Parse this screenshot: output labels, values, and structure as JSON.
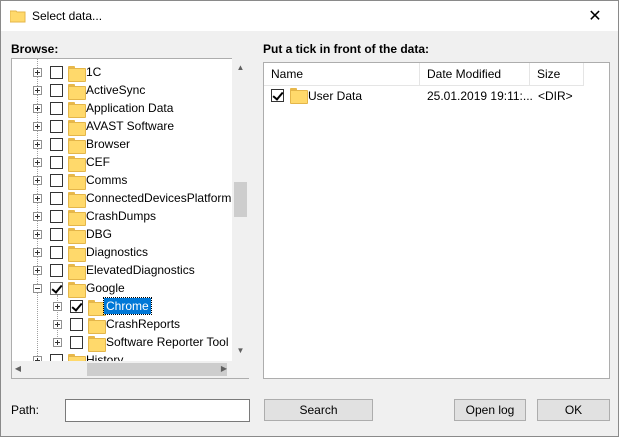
{
  "window": {
    "title": "Select data...",
    "close_glyph": "✕",
    "icon": "folder-icon"
  },
  "browse": {
    "label": "Browse:",
    "tree": [
      {
        "label": "1C",
        "level": 1,
        "expander": "plus",
        "checked": false
      },
      {
        "label": "ActiveSync",
        "level": 1,
        "expander": "plus",
        "checked": false
      },
      {
        "label": "Application Data",
        "level": 1,
        "expander": "plus",
        "checked": false
      },
      {
        "label": "AVAST Software",
        "level": 1,
        "expander": "plus",
        "checked": false
      },
      {
        "label": "Browser",
        "level": 1,
        "expander": "plus",
        "checked": false
      },
      {
        "label": "CEF",
        "level": 1,
        "expander": "plus",
        "checked": false
      },
      {
        "label": "Comms",
        "level": 1,
        "expander": "plus",
        "checked": false
      },
      {
        "label": "ConnectedDevicesPlatform",
        "level": 1,
        "expander": "plus",
        "checked": false
      },
      {
        "label": "CrashDumps",
        "level": 1,
        "expander": "plus",
        "checked": false
      },
      {
        "label": "DBG",
        "level": 1,
        "expander": "plus",
        "checked": false
      },
      {
        "label": "Diagnostics",
        "level": 1,
        "expander": "plus",
        "checked": false
      },
      {
        "label": "ElevatedDiagnostics",
        "level": 1,
        "expander": "plus",
        "checked": false
      },
      {
        "label": "Google",
        "level": 1,
        "expander": "minus",
        "checked": true,
        "partial": true
      },
      {
        "label": "Chrome",
        "level": 2,
        "expander": "plus",
        "checked": true,
        "selected": true
      },
      {
        "label": "CrashReports",
        "level": 2,
        "expander": "plus",
        "checked": false
      },
      {
        "label": "Software Reporter Tool",
        "level": 2,
        "expander": "plus",
        "checked": false
      },
      {
        "label": "History",
        "level": 1,
        "expander": "plus",
        "checked": false
      }
    ]
  },
  "data_panel": {
    "label": "Put a tick in front of the data:",
    "columns": [
      "Name",
      "Date Modified",
      "Size"
    ],
    "rows": [
      {
        "name": "User Data",
        "date": "25.01.2019 19:11:...",
        "size": "<DIR>",
        "checked": true
      }
    ]
  },
  "bottom": {
    "path_label": "Path:",
    "path_value": "",
    "search_label": "Search",
    "open_log_label": "Open log",
    "ok_label": "OK"
  }
}
